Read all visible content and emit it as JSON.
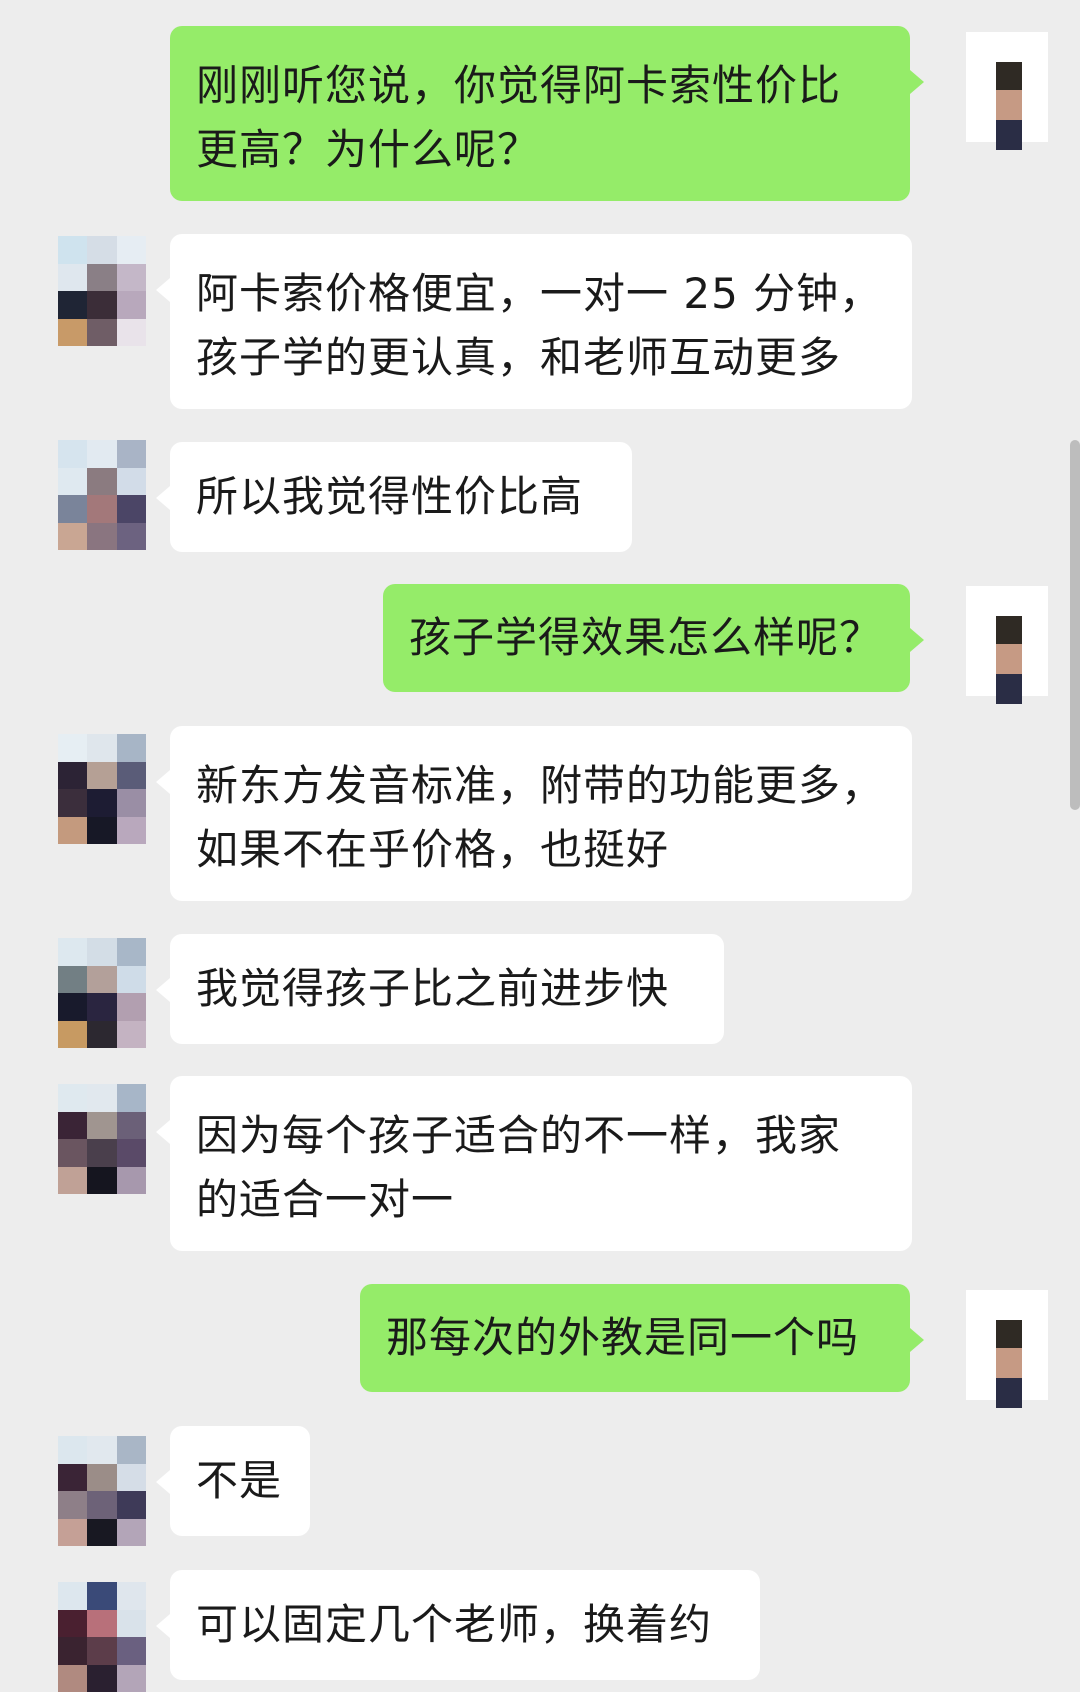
{
  "messages": [
    {
      "side": "right",
      "lines": [
        "刚刚听您说，你觉得阿卡索性价比",
        "更高？为什么呢？"
      ]
    },
    {
      "side": "left",
      "lines": [
        "阿卡索价格便宜，一对一 25 分钟，",
        "孩子学的更认真，和老师互动更多"
      ]
    },
    {
      "side": "left",
      "lines": [
        "所以我觉得性价比高"
      ]
    },
    {
      "side": "right",
      "lines": [
        "孩子学得效果怎么样呢？"
      ]
    },
    {
      "side": "left",
      "lines": [
        "新东方发音标准，附带的功能更多，",
        "如果不在乎价格，也挺好"
      ]
    },
    {
      "side": "left",
      "lines": [
        "我觉得孩子比之前进步快"
      ]
    },
    {
      "side": "left",
      "lines": [
        "因为每个孩子适合的不一样，我家",
        "的适合一对一"
      ]
    },
    {
      "side": "right",
      "lines": [
        "那每次的外教是同一个吗"
      ]
    },
    {
      "side": "left",
      "lines": [
        "不是"
      ]
    },
    {
      "side": "left",
      "lines": [
        "可以固定几个老师，换着约"
      ]
    }
  ],
  "colors": {
    "background": "#ededed",
    "bubble_self": "#95ec69",
    "bubble_other": "#ffffff"
  }
}
